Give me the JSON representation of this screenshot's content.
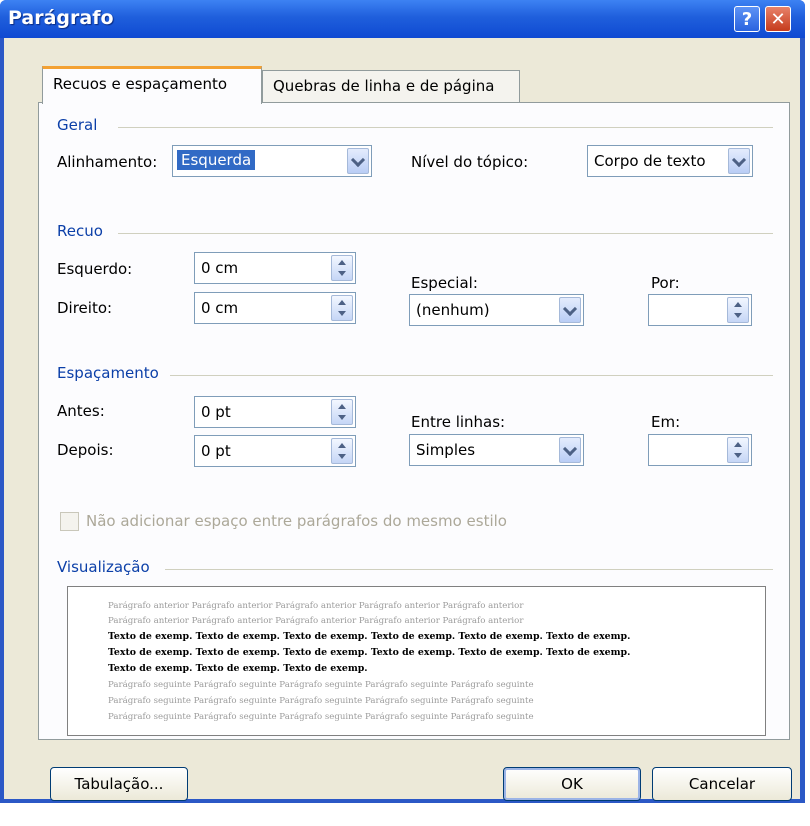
{
  "window": {
    "title": "Parágrafo"
  },
  "titlebar_buttons": {
    "help": "?",
    "close": "✕"
  },
  "tabs": [
    {
      "label": "Recuos e espaçamento",
      "active": true
    },
    {
      "label": "Quebras de linha e de página",
      "active": false
    }
  ],
  "geral": {
    "group_label": "Geral",
    "alinhamento_label": "Alinhamento:",
    "alinhamento_value": "Esquerda",
    "nivel_label": "Nível do tópico:",
    "nivel_value": "Corpo de texto"
  },
  "recuo": {
    "group_label": "Recuo",
    "esquerdo_label": "Esquerdo:",
    "esquerdo_value": "0 cm",
    "direito_label": "Direito:",
    "direito_value": "0 cm",
    "especial_label": "Especial:",
    "especial_value": "(nenhum)",
    "por_label": "Por:",
    "por_value": ""
  },
  "espacamento": {
    "group_label": "Espaçamento",
    "antes_label": "Antes:",
    "antes_value": "0 pt",
    "depois_label": "Depois:",
    "depois_value": "0 pt",
    "entre_linhas_label": "Entre linhas:",
    "entre_linhas_value": "Simples",
    "em_label": "Em:",
    "em_value": "",
    "checkbox_label": "Não adicionar espaço entre parágrafos do mesmo estilo",
    "checkbox_checked": false
  },
  "visualizacao": {
    "group_label": "Visualização",
    "lines": [
      {
        "text": "Parágrafo anterior Parágrafo anterior Parágrafo anterior Parágrafo anterior Parágrafo anterior",
        "style": "gray"
      },
      {
        "text": "Parágrafo anterior Parágrafo anterior Parágrafo anterior Parágrafo anterior Parágrafo anterior",
        "style": "gray"
      },
      {
        "text": "Texto de exemp. Texto de exemp. Texto de exemp. Texto de exemp. Texto de exemp. Texto de exemp.",
        "style": "bold"
      },
      {
        "text": "Texto de exemp. Texto de exemp. Texto de exemp. Texto de exemp. Texto de exemp. Texto de exemp.",
        "style": "bold"
      },
      {
        "text": "Texto de exemp. Texto de exemp. Texto de exemp.",
        "style": "bold"
      },
      {
        "text": "Parágrafo seguinte Parágrafo seguinte Parágrafo seguinte Parágrafo seguinte Parágrafo seguinte",
        "style": "gray"
      },
      {
        "text": "Parágrafo seguinte Parágrafo seguinte Parágrafo seguinte Parágrafo seguinte Parágrafo seguinte",
        "style": "gray"
      },
      {
        "text": "Parágrafo seguinte Parágrafo seguinte Parágrafo seguinte Parágrafo seguinte Parágrafo seguinte",
        "style": "gray"
      }
    ]
  },
  "footer": {
    "tabulacao_label": "Tabulação...",
    "ok_label": "OK",
    "cancelar_label": "Cancelar"
  },
  "colors": {
    "titlebar": "#0f4ad2",
    "group_label": "#0b3fa8",
    "selection": "#316ac5",
    "tab_highlight": "#f3a133"
  },
  "icons": {
    "spinner": "up-down-arrows",
    "dropdown": "chevron-down"
  }
}
